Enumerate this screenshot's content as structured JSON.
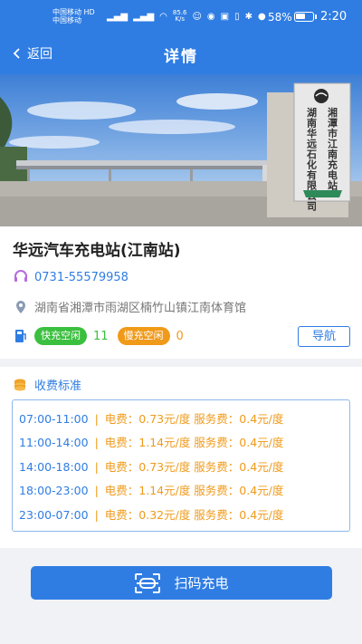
{
  "status_bar": {
    "carrier_1": "中国移动 HD",
    "carrier_2": "中国移动",
    "speed": "85.6",
    "speed_unit": "K/s",
    "battery": "58%",
    "battery_level": 0.58,
    "time": "2:20"
  },
  "nav": {
    "back_label": "返回",
    "title": "详情"
  },
  "station": {
    "name": "华远汽车充电站(江南站)",
    "phone": "0731-55579958",
    "address": "湖南省湘潭市雨湖区楠竹山镇江南体育馆",
    "fast_label": "快充空闲",
    "fast_count": "11",
    "slow_label": "慢充空闲",
    "slow_count": "0",
    "navigate_label": "导航"
  },
  "photo": {
    "sign_col1": "湘潭市江南充电站",
    "sign_col2": "湖南华远石化有限公司"
  },
  "fees": {
    "title": "收费标准",
    "rows": [
      {
        "time": "07:00-11:00",
        "sep": "|",
        "rate": "电费：0.73元/度  服务费：0.4元/度"
      },
      {
        "time": "11:00-14:00",
        "sep": "|",
        "rate": "电费：1.14元/度  服务费：0.4元/度"
      },
      {
        "time": "14:00-18:00",
        "sep": "|",
        "rate": "电费：0.73元/度  服务费：0.4元/度"
      },
      {
        "time": "18:00-23:00",
        "sep": "|",
        "rate": "电费：1.14元/度  服务费：0.4元/度"
      },
      {
        "time": "23:00-07:00",
        "sep": "|",
        "rate": "电费：0.32元/度  服务费：0.4元/度"
      }
    ]
  },
  "scan": {
    "label": "扫码充电"
  },
  "colors": {
    "primary": "#2f7de3",
    "green": "#3bbf3f",
    "orange": "#f09a1a"
  }
}
